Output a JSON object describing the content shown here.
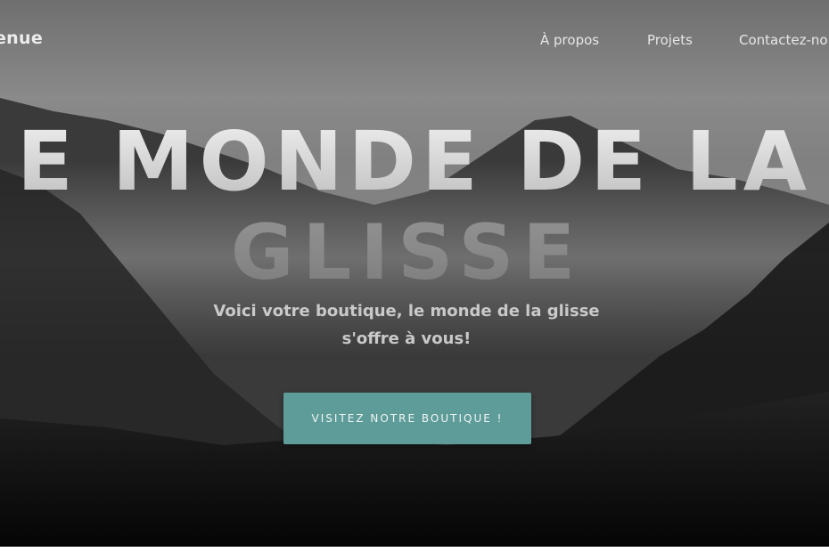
{
  "header": {
    "brand": "enue",
    "nav": [
      {
        "label": "À propos"
      },
      {
        "label": "Projets"
      },
      {
        "label": "Contactez-no"
      }
    ]
  },
  "hero": {
    "title_line1": "E MONDE DE LA",
    "title_line2": "GLISSE",
    "tagline_line1": "Voici votre boutique, le monde de la glisse",
    "tagline_line2": "s'offre à vous!",
    "cta_label": "VISITEZ NOTRE BOUTIQUE !"
  },
  "colors": {
    "accent": "#5e9c99",
    "text_light": "#e6e6e6"
  }
}
